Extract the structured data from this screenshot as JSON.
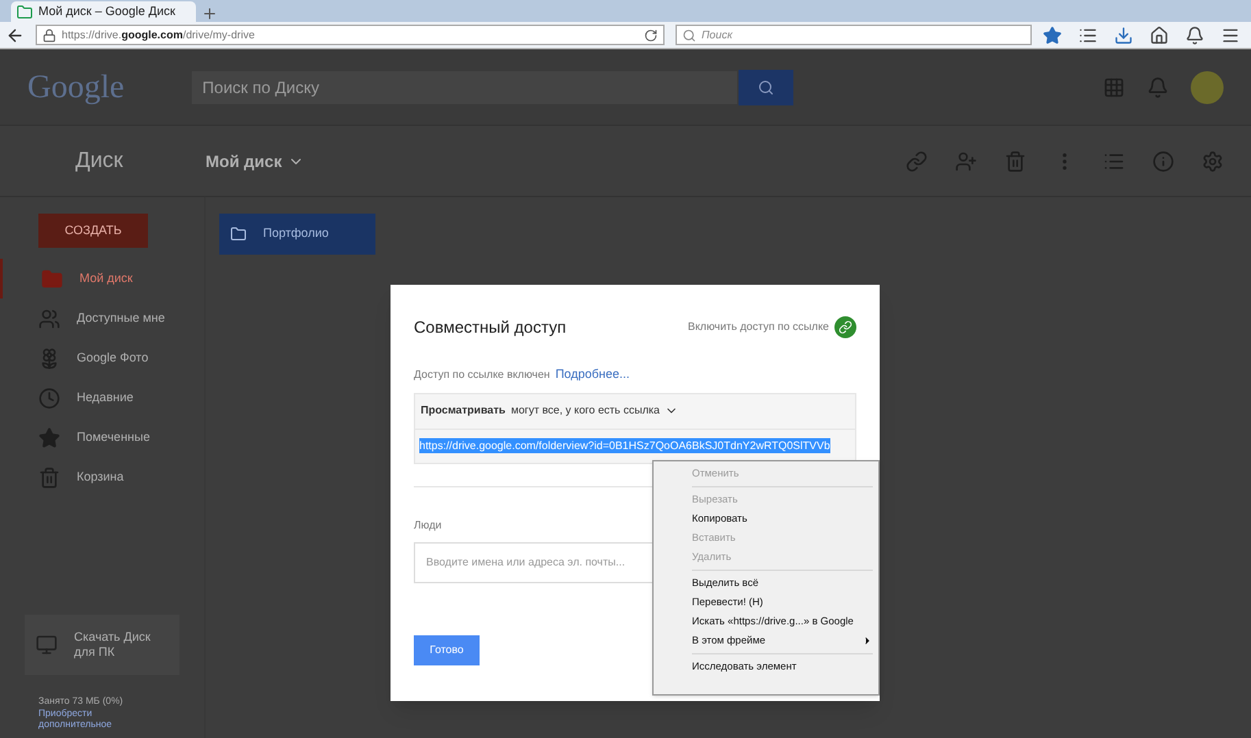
{
  "browser": {
    "tab_title": "Мой диск – Google Диск",
    "url_prefix": "https://drive.",
    "url_host": "google.com",
    "url_path": "/drive/my-drive",
    "search_placeholder": "Поиск"
  },
  "header": {
    "logo": "Google",
    "search_placeholder": "Поиск по Диску"
  },
  "toolbar": {
    "app_title": "Диск",
    "breadcrumb": "Мой диск"
  },
  "sidebar": {
    "create_button": "СОЗДАТЬ",
    "items": [
      {
        "label": "Мой диск",
        "selected": true,
        "kind": "folder"
      },
      {
        "label": "Доступные мне",
        "selected": false,
        "kind": "people"
      },
      {
        "label": "Google Фото",
        "selected": false,
        "kind": "photos"
      },
      {
        "label": "Недавние",
        "selected": false,
        "kind": "clock"
      },
      {
        "label": "Помеченные",
        "selected": false,
        "kind": "star"
      },
      {
        "label": "Корзина",
        "selected": false,
        "kind": "trash"
      }
    ],
    "download": "Скачать Диск для ПК",
    "storage": "Занято 73 МБ (0%)",
    "storage_link": "Приобрести дополнительное"
  },
  "files": [
    {
      "name": "Портфолио",
      "selected": true
    }
  ],
  "dialog": {
    "title": "Совместный доступ",
    "link_toggle": "Включить доступ по ссылке",
    "status": "Доступ по ссылке включен",
    "more_link": "Подробнее...",
    "permission_bold": "Просматривать",
    "permission_rest": "могут все, у кого есть ссылка",
    "link": "https://drive.google.com/folderview?id=0B1HSz7QoOA6BkSJ0TdnY2wRTQ0SlTVVb",
    "people_label": "Люди",
    "people_placeholder": "Вводите имена или адреса эл. почты...",
    "done_button": "Готово"
  },
  "context_menu": [
    {
      "kind": "item",
      "label": "Отменить",
      "disabled": true
    },
    {
      "kind": "separator"
    },
    {
      "kind": "item",
      "label": "Вырезать",
      "disabled": true
    },
    {
      "kind": "item",
      "label": "Копировать",
      "disabled": false
    },
    {
      "kind": "item",
      "label": "Вставить",
      "disabled": true
    },
    {
      "kind": "item",
      "label": "Удалить",
      "disabled": true
    },
    {
      "kind": "separator"
    },
    {
      "kind": "item",
      "label": "Выделить всё",
      "disabled": false
    },
    {
      "kind": "item",
      "label": "Перевести! (H)",
      "disabled": false
    },
    {
      "kind": "item",
      "label": "Искать «https://drive.g...» в Google",
      "disabled": false
    },
    {
      "kind": "submenu",
      "label": "В этом фрейме",
      "disabled": false
    },
    {
      "kind": "separator"
    },
    {
      "kind": "item",
      "label": "Исследовать элемент",
      "disabled": false
    }
  ]
}
